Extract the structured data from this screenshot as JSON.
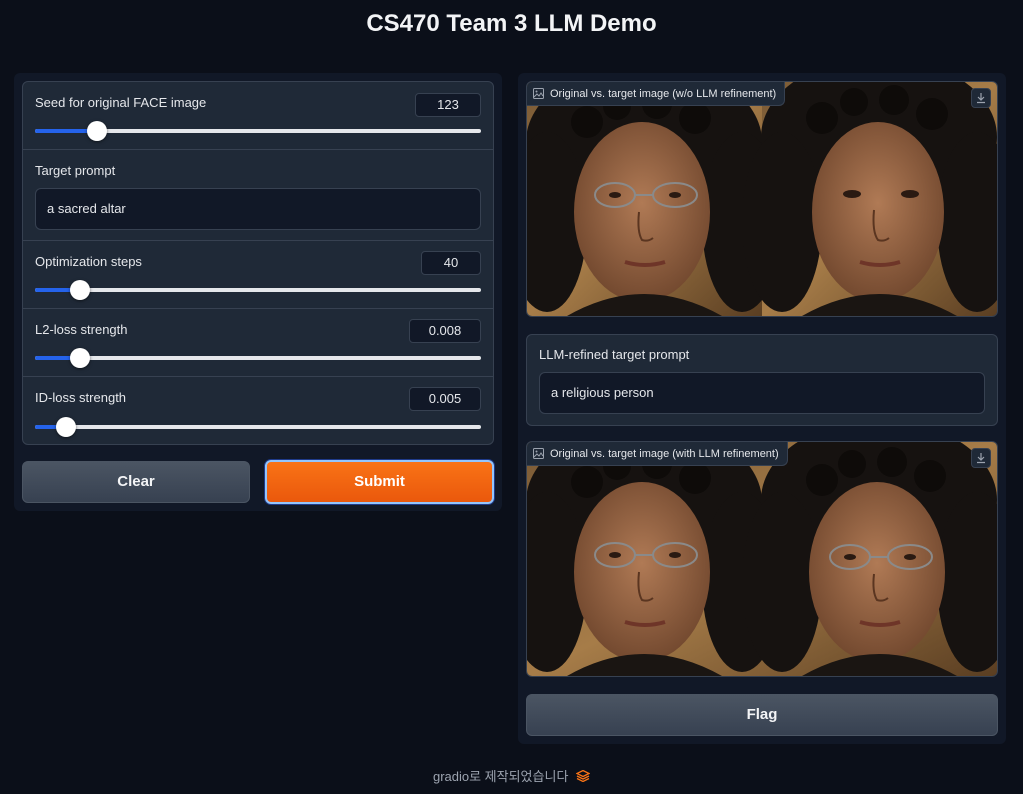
{
  "page": {
    "title": "CS470 Team 3 LLM Demo"
  },
  "inputs": {
    "seed": {
      "label": "Seed for original FACE image",
      "value": "123",
      "slider_fraction": 0.14
    },
    "target_prompt": {
      "label": "Target prompt",
      "value": "a sacred altar"
    },
    "steps": {
      "label": "Optimization steps",
      "value": "40",
      "slider_fraction": 0.1
    },
    "l2": {
      "label": "L2-loss strength",
      "value": "0.008",
      "slider_fraction": 0.1
    },
    "id": {
      "label": "ID-loss strength",
      "value": "0.005",
      "slider_fraction": 0.07
    }
  },
  "actions": {
    "clear_label": "Clear",
    "submit_label": "Submit",
    "flag_label": "Flag"
  },
  "outputs": {
    "image1_label": "Original vs. target image (w/o LLM refinement)",
    "refined_label": "LLM-refined target prompt",
    "refined_value": "a religious person",
    "image2_label": "Original vs. target image (with LLM refinement)"
  },
  "footer": {
    "text": "gradio로 제작되었습니다"
  },
  "colors": {
    "accent": "#f97316",
    "slider": "#2563eb",
    "background": "#0b0f19"
  },
  "icons": [
    "image-icon",
    "download-icon",
    "gradio-logo-icon"
  ]
}
